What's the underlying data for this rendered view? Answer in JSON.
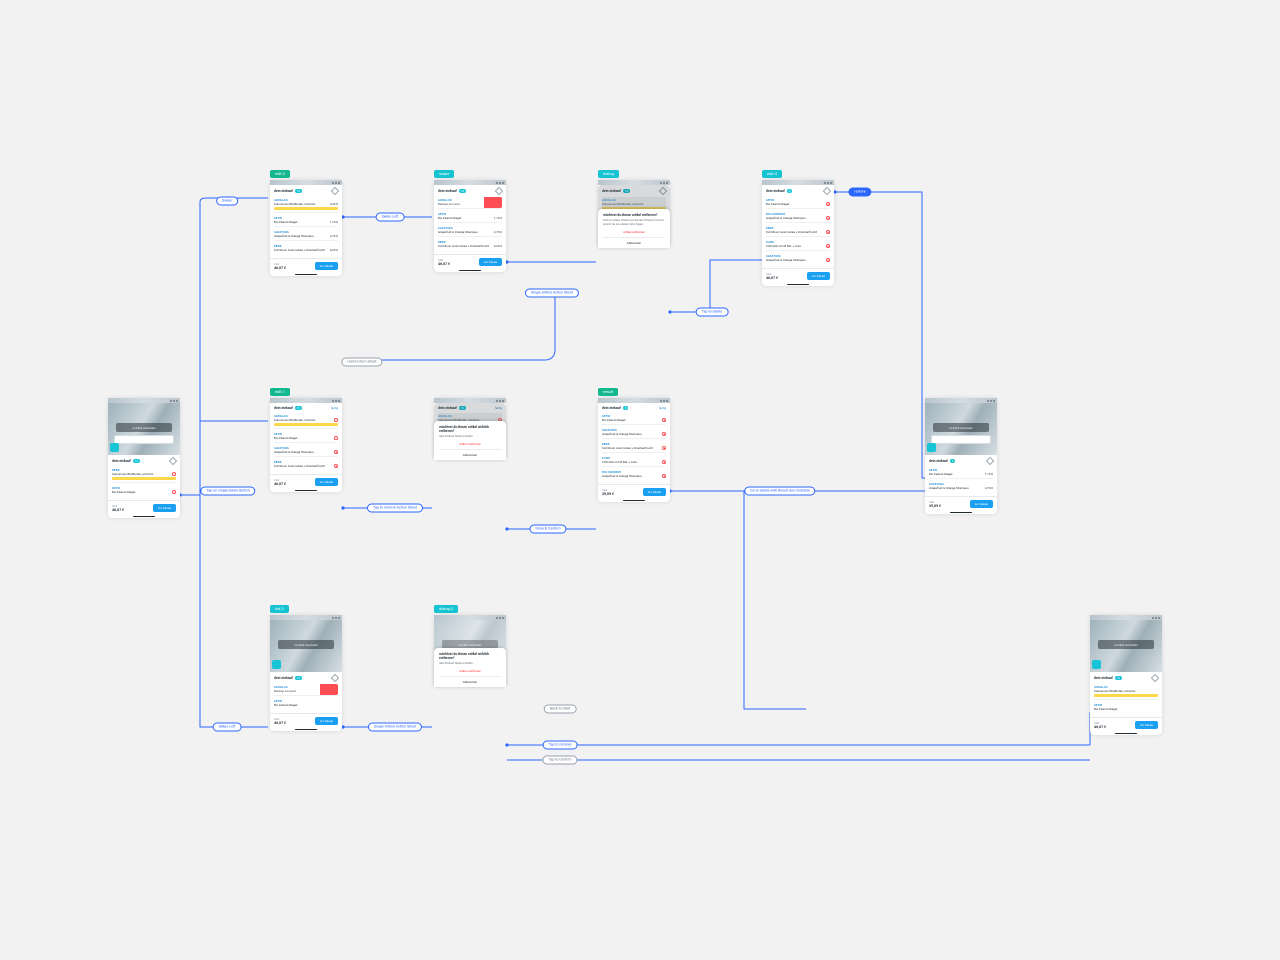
{
  "header_title": "dein einkauf",
  "counts": {
    "full": "12",
    "small": "3"
  },
  "edit_label": "fertig",
  "hero_btn": "zu Flink wechseln",
  "stores": {
    "gorillas": "GORILLAS",
    "flink": "FLINK",
    "alnatura": "ALNATURA",
    "rewe": "REWE",
    "bio_company": "BIO COMPANY",
    "getir": "GETIR"
  },
  "items": {
    "charcoal": "Kokosnuss Blattkohle, schwarz",
    "peanut": "Bio Peanut Riegel",
    "grapefruit": "Grapefruit & Orange Shampoo",
    "fullmoon": "Full Moon Acai Cubes + Drachenfrucht",
    "bbq": "Chili-Grill Jim B Bar + Cola",
    "backup": "Backup Account"
  },
  "prices": {
    "p1": "4,49 €",
    "p2": "1,19 €",
    "p3": "2,79 €",
    "p4": "6,29 €",
    "p5": "4,29 €"
  },
  "totals": {
    "t1": "46,87 €",
    "t2": "39,89 €"
  },
  "total_label": "total",
  "cta": "zur Kasse",
  "dialog": {
    "q": "möchtest du diesen artikel entfernen?",
    "q2": "möchtest du diesen artikel wirklich entfernen?",
    "s": "Falls du diese Artikel aus deinem Einkauf löschst, kannst du sie wieder hinzufügen.",
    "s2": "dein Einkauf bleibt erhalten.",
    "danger": "artikel entfernen",
    "cancel": "Abbrechen"
  },
  "labels": {
    "swipe": "Swipe",
    "swipe_left": "Swipe Left",
    "restore": "restore item Sheet",
    "tap_remove": "Tap to remove Action Sheet",
    "tap_single": "Tap on single delete Button",
    "single_remove": "Single Artikel Action Sheet",
    "tap_delete": "Tap to delete",
    "back": "Back to Start",
    "restore_link": "restore",
    "done": "Done & Confirm",
    "toast": "Go to delete with Result aus Undelete",
    "tap_remove2": "Tap to remove",
    "tap_confirm": "Tap to confirm"
  }
}
